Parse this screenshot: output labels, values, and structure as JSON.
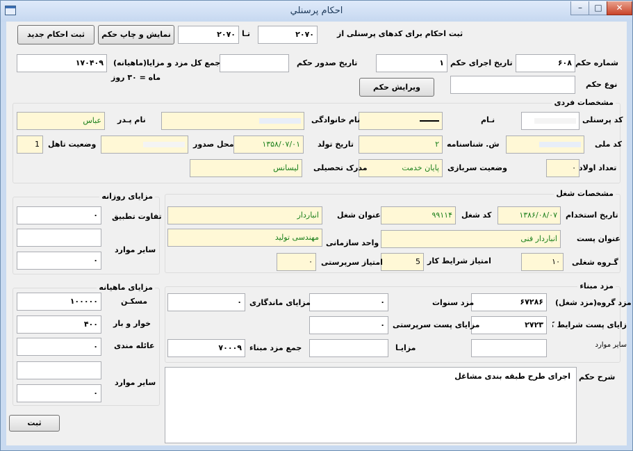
{
  "window": {
    "title": "احکام پرسنلي"
  },
  "top": {
    "register_label": "ثبت احکام برای کدهای پرسنلی از",
    "from_value": "۲۰۷۰",
    "to_label": "تـا",
    "to_value": "۲۰۷۰",
    "show_print_button": "نمایش و چاپ حکم",
    "new_button": "ثبت احکام جدید"
  },
  "header": {
    "order_number_label": "شماره حکم",
    "order_number": "۶۰۸",
    "exec_date_label": "تاریخ اجرای حکم",
    "exec_date": "۱",
    "issue_date_label": "تاریخ صدور حکم",
    "issue_date": "",
    "total_label": "جمع کل مزد و مزایا(ماهیانه)",
    "total_note": "ماه = ۳۰ روز",
    "total": "۱۷۰۴۰۹",
    "order_type_label": "نوع حکم",
    "order_type": "",
    "edit_button": "ویرایش حکم"
  },
  "personal": {
    "title": "مشخصات فردی",
    "code_label": "کد پرسنلی",
    "code": "",
    "name_label": "نـام",
    "name": "",
    "family_label": "نام خانوادگی",
    "family": "",
    "father_label": "نام پـدر",
    "father": "عباس",
    "national_label": "کد ملی",
    "national": "",
    "id_number_label": "ش. شناسنامه",
    "id_number": "۲",
    "birth_label": "تاریخ تولد",
    "birth": "۱۳۵۸/۰۷/۰۱",
    "place_label": "محل صدور",
    "place": "",
    "marital_label": "وضعیت تاهل",
    "marital": "1",
    "children_label": "تعداد اولاد",
    "children": "۰",
    "military_label": "وضعیت سربازی",
    "military": "پایان خدمت",
    "degree_label": "مدرک تحصیلی",
    "degree": "لیسانس"
  },
  "job": {
    "title": "مشخصات شغل",
    "hire_label": "تاریخ استخدام",
    "hire": "۱۳۸۶/۰۸/۰۷",
    "job_code_label": "کد شغل",
    "job_code": "۹۹۱۱۴",
    "job_title_label": "عنوان شغل",
    "job_title": "انباردار",
    "post_label": "عنوان پست",
    "post": "انباردار فنی",
    "unit_label": "واحد سازمانی",
    "unit": "مهندسی تولید",
    "group_label": "گـروه شغلی",
    "group": "۱۰",
    "condition_label": "امتیاز شرایط کار",
    "condition": "5",
    "super_label": "امتیاز سرپرستی",
    "super": "۰"
  },
  "daily": {
    "title": "مزایای روزانه",
    "diff_label": "تفاوت تطبیق",
    "diff": "۰",
    "other_label": "سایر موارد",
    "other1": "",
    "other2": "۰"
  },
  "monthly": {
    "title": "مزایای ماهیانه",
    "housing_label": "مسکـن",
    "housing": "۱۰۰۰۰۰",
    "food_label": "خوار و بار",
    "food": "۴۰۰",
    "family_label": "عائله مندی",
    "family": "۰",
    "other_label": "سایر موارد",
    "other1": "",
    "other2": "۰"
  },
  "wage": {
    "title": "مزد مبناء",
    "group_wage_label": "مزد گروه(مزد شغل)",
    "group_wage": "۶۷۲۸۶",
    "years_label": "مزد سنوات",
    "years": "۰",
    "stay_label": "مزایای ماندگاری",
    "stay": "۰",
    "post_cond_label": "زایای پست شرایط کار",
    "post_cond": "۲۷۲۳",
    "post_super_label": "مزایای پست سرپرستی",
    "post_super": "۰",
    "other_label": "سایر موارد",
    "other": "",
    "benefits_label": "مزایـا",
    "benefits": "",
    "base_total_label": "جمع مزد مبناء",
    "base_total": "۷۰۰۰۹"
  },
  "desc": {
    "label": "شرح حکم",
    "text": "اجرای طرح طبقه بندی مشاغل"
  },
  "footer": {
    "save_button": "ثبت"
  }
}
